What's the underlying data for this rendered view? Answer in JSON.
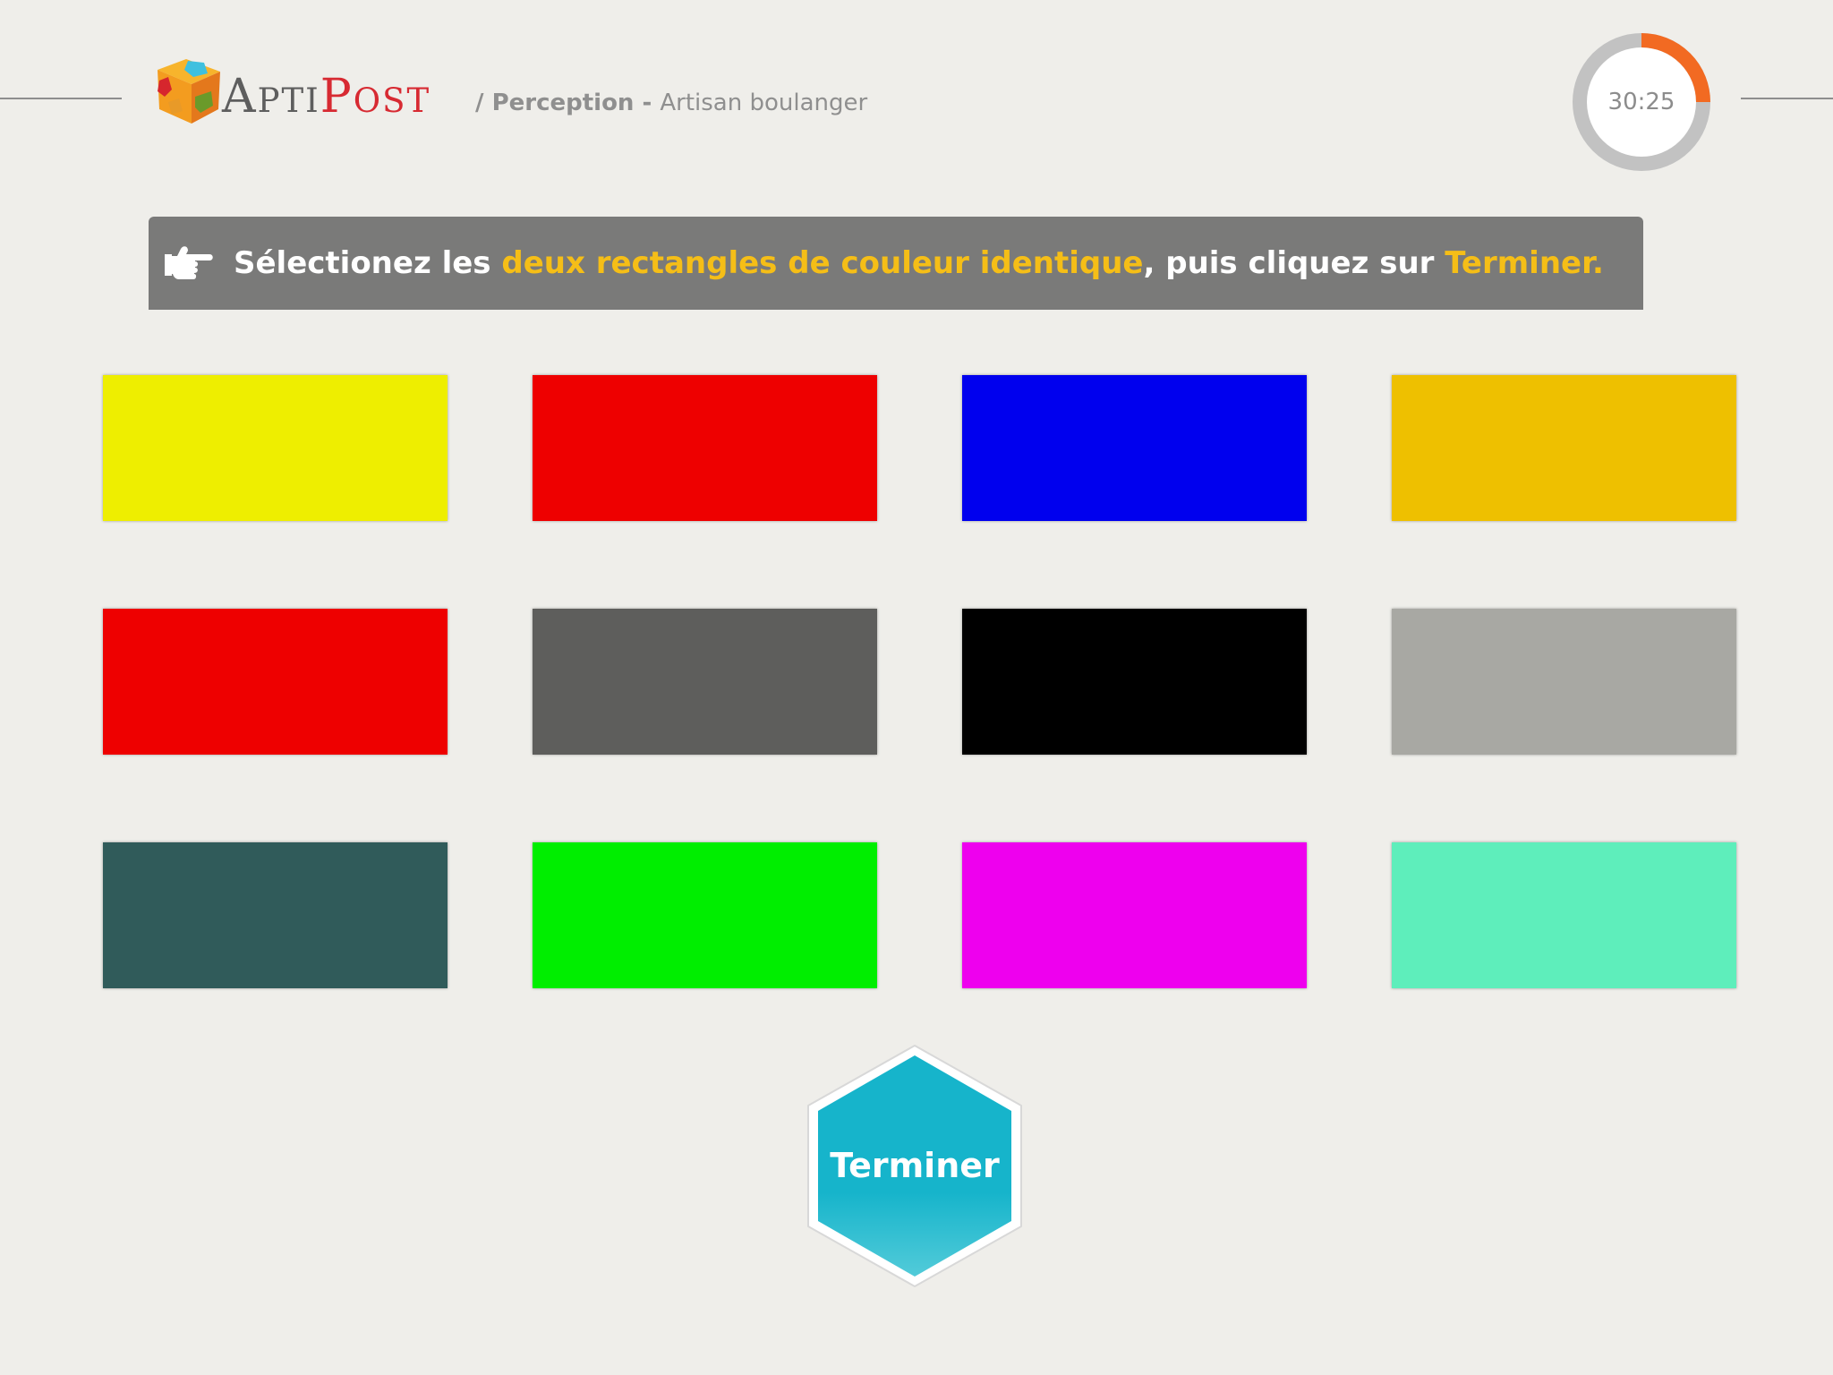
{
  "header": {
    "logo": {
      "name": "AptiPost",
      "apti_cap": "A",
      "apti_rest": "PTI",
      "post_cap": "P",
      "post_rest": "OST"
    },
    "breadcrumb": {
      "separator": "/ ",
      "section": "Perception",
      "dash": " - ",
      "page": "Artisan boulanger"
    },
    "timer": {
      "label": "30:25",
      "elapsed_fraction": 0.25,
      "track_color": "#c2c2c2",
      "progress_color": "#f26a22"
    }
  },
  "instruction": {
    "icon": "pointing-hand-icon",
    "parts": [
      {
        "text": "Sélectionez les ",
        "highlight": false
      },
      {
        "text": "deux rectangles de couleur identique",
        "highlight": true
      },
      {
        "text": ", puis cliquez sur ",
        "highlight": false
      },
      {
        "text": "Terminer.",
        "highlight": true
      }
    ],
    "highlight_color": "#f5be17",
    "background_color": "#7a7a79"
  },
  "swatches": [
    [
      "#eeee00",
      "#ee0000",
      "#0000ee",
      "#eec000"
    ],
    [
      "#ee0000",
      "#5e5e5c",
      "#000000",
      "#a8a8a3"
    ],
    [
      "#305b5a",
      "#00ee00",
      "#ee00ee",
      "#5eeebb"
    ]
  ],
  "finish_button": {
    "label": "Terminer",
    "color": "#16b4cb"
  }
}
